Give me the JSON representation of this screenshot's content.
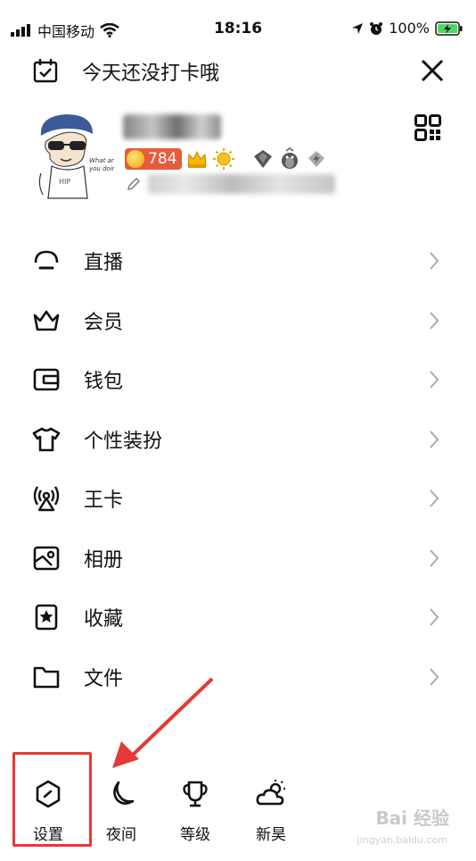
{
  "status_bar": {
    "carrier": "中国移动",
    "time": "18:16",
    "battery": "100%"
  },
  "header": {
    "checkin_text": "今天还没打卡哦"
  },
  "profile": {
    "coin_count": "784"
  },
  "menu": {
    "items": [
      {
        "label": "直播",
        "icon": "live-icon"
      },
      {
        "label": "会员",
        "icon": "crown-icon"
      },
      {
        "label": "钱包",
        "icon": "wallet-icon"
      },
      {
        "label": "个性装扮",
        "icon": "shirt-icon"
      },
      {
        "label": "王卡",
        "icon": "signal-tower-icon"
      },
      {
        "label": "相册",
        "icon": "photo-album-icon"
      },
      {
        "label": "收藏",
        "icon": "bookmark-star-icon"
      },
      {
        "label": "文件",
        "icon": "folder-icon"
      }
    ]
  },
  "bottom_bar": {
    "items": [
      {
        "label": "设置",
        "icon": "settings-hexagon-icon"
      },
      {
        "label": "夜间",
        "icon": "moon-icon"
      },
      {
        "label": "等级",
        "icon": "level-trophy-icon"
      },
      {
        "label": "新昊",
        "icon": "weather-sun-cloud-icon"
      }
    ]
  },
  "watermark": {
    "brand": "Bai 经验",
    "url": "jingyan.baidu.com"
  },
  "colors": {
    "annotation_red": "#e53935",
    "coin_badge": "#e85b3a",
    "battery_green": "#4cd964"
  }
}
